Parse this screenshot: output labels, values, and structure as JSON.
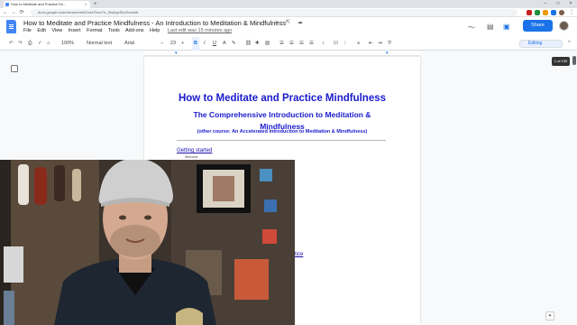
{
  "browser": {
    "tab_title": "How to Meditate and Practice Mi...",
    "tab_close": "×",
    "new_tab": "+",
    "url": "docs.google.com/document/d/1ssLFlnwYb_9kwkgxShoSm/edit",
    "window_controls": [
      "–",
      "□",
      "×"
    ],
    "nav": {
      "back": "←",
      "forward": "→",
      "reload": "⟳"
    }
  },
  "docs": {
    "title": "How to Meditate and Practice Mindfulness - An Introduction to Meditation & Mindfulness",
    "title_icons": "☆ ⇱ ☁",
    "menu": [
      "File",
      "Edit",
      "View",
      "Insert",
      "Format",
      "Tools",
      "Add-ons",
      "Help"
    ],
    "last_edit": "Last edit was 15 minutes ago",
    "share_label": "Share",
    "editing_label": "Editing",
    "toolbar": {
      "zoom": "100%",
      "style": "Normal text",
      "font": "Arial",
      "font_size": "23"
    },
    "page_badge": "1 of 159"
  },
  "document": {
    "heading1": "How to Meditate and Practice Mindfulness",
    "heading2": "The Comprehensive Introduction to Meditation & Mindfulness",
    "heading3": "(other course: An Accelerated Introduction to Meditation & Mindfulness)",
    "toc": [
      {
        "label": "Getting started"
      },
      {
        "label": "Welcome"
      }
    ],
    "partial_link": "tice"
  },
  "icons": {
    "undo": "undo-icon",
    "redo": "redo-icon",
    "print": "print-icon",
    "spellcheck": "spellcheck-icon",
    "paint_format": "paint-format-icon",
    "bold": "bold-icon",
    "italic": "italic-icon",
    "underline": "underline-icon"
  },
  "colors": {
    "heading": "#1a1ace",
    "link": "#1a0dab",
    "share": "#1a73e8",
    "docs_logo": "#4285f4"
  }
}
